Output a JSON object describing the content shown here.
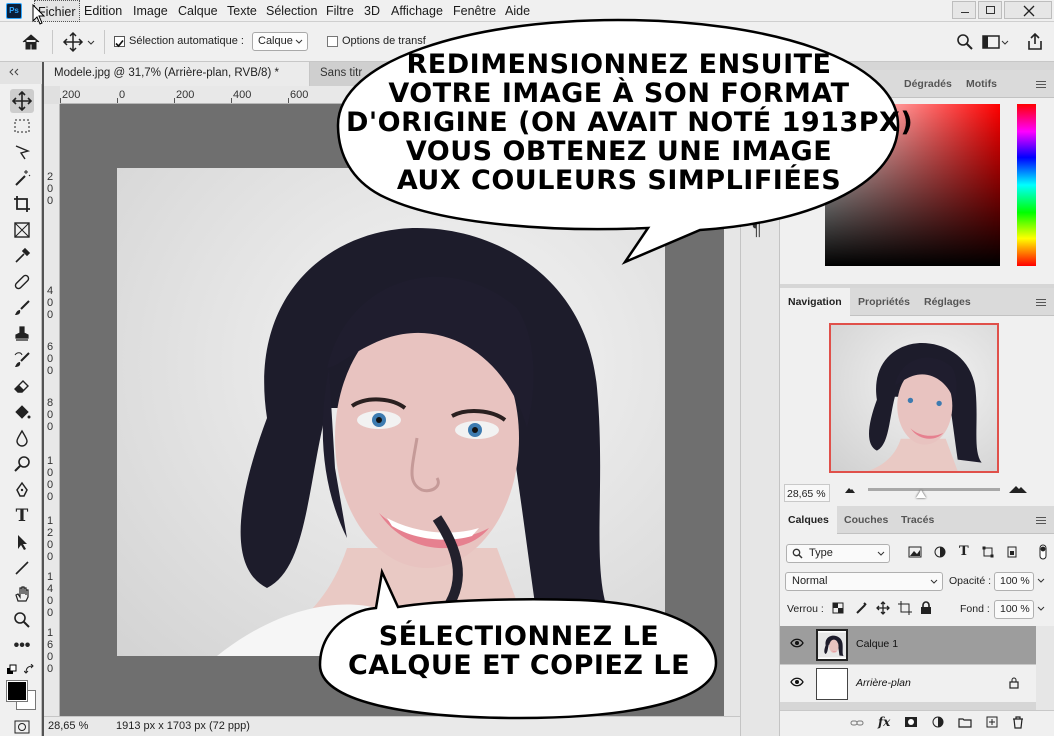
{
  "app": {
    "logo": "Ps",
    "menu": [
      "Fichier",
      "Edition",
      "Image",
      "Calque",
      "Texte",
      "Sélection",
      "Filtre",
      "3D",
      "Affichage",
      "Fenêtre",
      "Aide"
    ]
  },
  "options_bar": {
    "auto_select_label": "Sélection automatique :",
    "auto_select_checked": true,
    "target_select_value": "Calque",
    "transform_controls_label": "Options de transf"
  },
  "tabs": [
    {
      "label": "Modele.jpg @ 31,7% (Arrière-plan, RVB/8) *",
      "active": true
    },
    {
      "label": "Sans titr",
      "active": false
    }
  ],
  "ruler": {
    "top": [
      "200",
      "0",
      "200",
      "400",
      "600"
    ],
    "left": [
      "2",
      "0",
      "0",
      "4",
      "0",
      "0",
      "6",
      "0",
      "0",
      "8",
      "0",
      "0",
      "1",
      "0",
      "0",
      "0",
      "1",
      "2",
      "0",
      "0",
      "1",
      "4",
      "0",
      "0",
      "1",
      "6",
      "0",
      "0"
    ]
  },
  "status": {
    "zoom": "28,65 %",
    "doc_info": "1913 px x 1703 px (72 ppp)"
  },
  "color_panel": {
    "tabs": [
      "Dégradés",
      "Motifs"
    ]
  },
  "navigator_panel": {
    "tabs": [
      "Navigation",
      "Propriétés",
      "Réglages"
    ],
    "zoom": "28,65 %"
  },
  "layers_panel": {
    "tabs": [
      "Calques",
      "Couches",
      "Tracés"
    ],
    "filter_label": "Type",
    "blend_mode": "Normal",
    "opacity_label": "Opacité :",
    "opacity_value": "100 %",
    "lock_label": "Verrou :",
    "fill_label": "Fond :",
    "fill_value": "100 %",
    "layers": [
      {
        "name": "Calque 1",
        "selected": true,
        "visible": true
      },
      {
        "name": "Arrière-plan",
        "selected": false,
        "visible": true,
        "locked": true
      }
    ],
    "footer_icons": [
      "link-icon",
      "fx-icon",
      "mask-icon",
      "adjustment-icon",
      "folder-icon",
      "new-layer-icon",
      "trash-icon"
    ]
  },
  "annotations": {
    "top_bubble": [
      "REDIMENSIONNEZ ENSUITE",
      "VOTRE IMAGE À SON FORMAT",
      "D'ORIGINE (ON AVAIT NOTÉ 1913PX)",
      "VOUS OBTENEZ UNE IMAGE",
      "AUX COULEURS SIMPLIFIÉES"
    ],
    "bottom_bubble": [
      "SÉLECTIONNEZ LE",
      "CALQUE ET COPIEZ LE"
    ]
  },
  "colors": {
    "accent_nav_frame": "#e0504a",
    "foreground_swatch": "#000000",
    "background_swatch": "#ffffff"
  }
}
